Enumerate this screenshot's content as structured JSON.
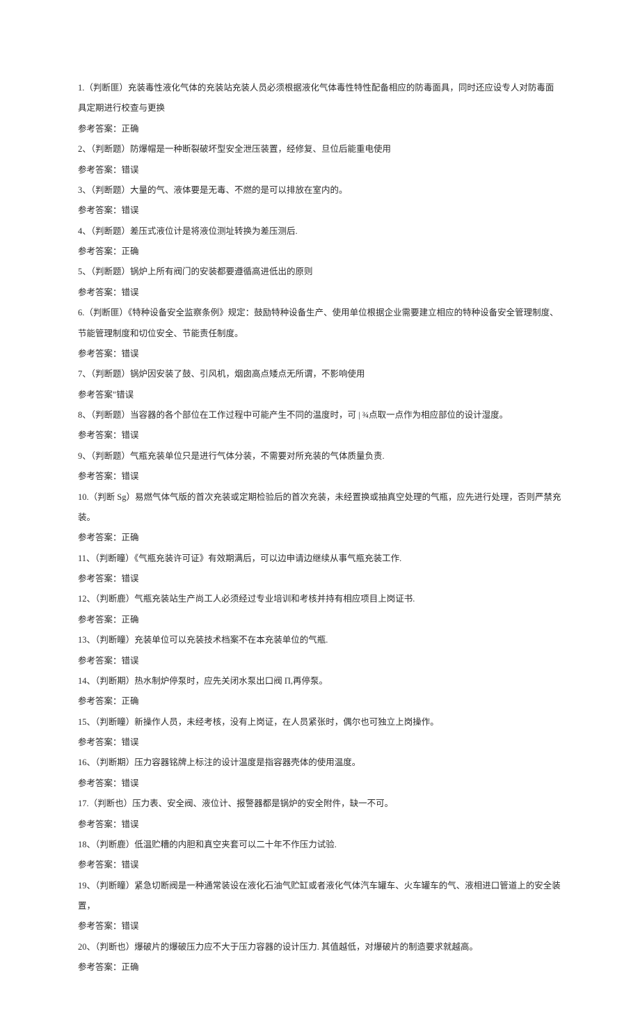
{
  "answer_label": "参考答案：",
  "answer_label_variant": "参考答案\"",
  "items": [
    {
      "n": "1.",
      "tag": "（判断匪）",
      "q": "充装毒性液化气体的充装站充装人员必须根据液化气体毒性特性配备相应的防毒面具，同时还应设专人对防毒面具定期进行校查与更换",
      "a": "正确",
      "alabel": "std"
    },
    {
      "n": "2、",
      "tag": "（判断题）",
      "q": "防爆帽是一种断裂破坏型安全泄压装置，经修复、旦位后能重电使用",
      "a": "错误",
      "alabel": "std"
    },
    {
      "n": "3、",
      "tag": "（判断题）",
      "q": "大量的气、液体要是无毒、不燃的是可以排放在室内的。",
      "a": "错误",
      "alabel": "std"
    },
    {
      "n": "4、",
      "tag": "（判断题）",
      "q": "差压式液位计是将液位测址转换为差压测后.",
      "a": "正确",
      "alabel": "std"
    },
    {
      "n": "5、",
      "tag": "（判断题）",
      "q": "锅炉上所有阀门的安装都要遵循高进低出的原则",
      "a": "错误",
      "alabel": "std"
    },
    {
      "n": "6.",
      "tag": "（判断匪）",
      "q": "《特种设备安全监察条例》规定：鼓励特种设备生产、使用单位根据企业需要建立相应的特种设备安全管理制度、节能管理制度和切位安全、节能责任制度。",
      "a": "错误",
      "alabel": "std"
    },
    {
      "n": "7、",
      "tag": "（判断题）",
      "q": "锅炉因安装了鼓、引风机，烟囱高点矮点无所谓，不影响使用",
      "a": "错误",
      "alabel": "variant"
    },
    {
      "n": "8、",
      "tag": "（判断题）",
      "q": "当容器的各个部位在工作过程中可能产生不同的温度时，可 | ¾点取一点作为相应部位的设计湿度。",
      "a": "错误",
      "alabel": "std"
    },
    {
      "n": "9、",
      "tag": "（判断题）",
      "q": "气瓶充装单位只是进行气体分装，不需要对所充装的气体质量负责.",
      "a": "错误",
      "alabel": "std"
    },
    {
      "n": "10.",
      "tag": "（判断 Sg）",
      "q": "易燃气体气版的首次充装或定期检验后的首次充装，未经置换或抽真空处理的气瓶，应先进行处理，否则严禁充装。",
      "a": "正确",
      "alabel": "std"
    },
    {
      "n": "11、",
      "tag": "（判断瞳）",
      "q": "《气瓶充装许可证》有效期满后，可以边申请边继续从事气瓶充装工作.",
      "a": "错误",
      "alabel": "std"
    },
    {
      "n": "12、",
      "tag": "（判断鹿）",
      "q": "气瓶充装站生产尚工人必须经过专业培训和考核并持有相应项目上岗证书.",
      "a": "正确",
      "alabel": "std"
    },
    {
      "n": "13、",
      "tag": "（判断瞳）",
      "q": "充装单位可以充装技术档案不在本充装单位的气瓶.",
      "a": "错误",
      "alabel": "std"
    },
    {
      "n": "14、",
      "tag": "（判断期）",
      "q": "热水制炉停泵时，应先关闭水泵出口阀 Π,再停泵。",
      "a": "正确",
      "alabel": "std"
    },
    {
      "n": "15、",
      "tag": "（判断瞳）",
      "q": "新操作人员，未经考核，没有上岗证，在人员紧张时，偶尔也可独立上岗操作。",
      "a": "错误",
      "alabel": "std"
    },
    {
      "n": "16、",
      "tag": "（判断期）",
      "q": "压力容器铭牌上标注的设计温度是指容器壳体的使用温度。",
      "a": "错误",
      "alabel": "std"
    },
    {
      "n": "17.",
      "tag": "（判断也）",
      "q": "压力表、安全阀、液位计、报警器都是锅炉的安全附件，缺一不可。",
      "a": "错误",
      "alabel": "std"
    },
    {
      "n": "18、",
      "tag": "（判断鹿）",
      "q": "低温贮糟的内胆和真空夹套可以二十年不作压力试验.",
      "a": "错误",
      "alabel": "std"
    },
    {
      "n": "19、",
      "tag": "（判断瞳）",
      "q": "紧急切断阀是一种通常装设在液化石油气贮缸或者液化气体汽车罐车、火车罐车的气、液相进口管道上的安全装置，",
      "a": "错误",
      "alabel": "std"
    },
    {
      "n": "20、",
      "tag": "（判断也）",
      "q": "爆破片的爆破压力应不大于压力容器的设计压力. 其值越低，对爆破片的制造要求就越高。",
      "a": "正确",
      "alabel": "std"
    }
  ]
}
